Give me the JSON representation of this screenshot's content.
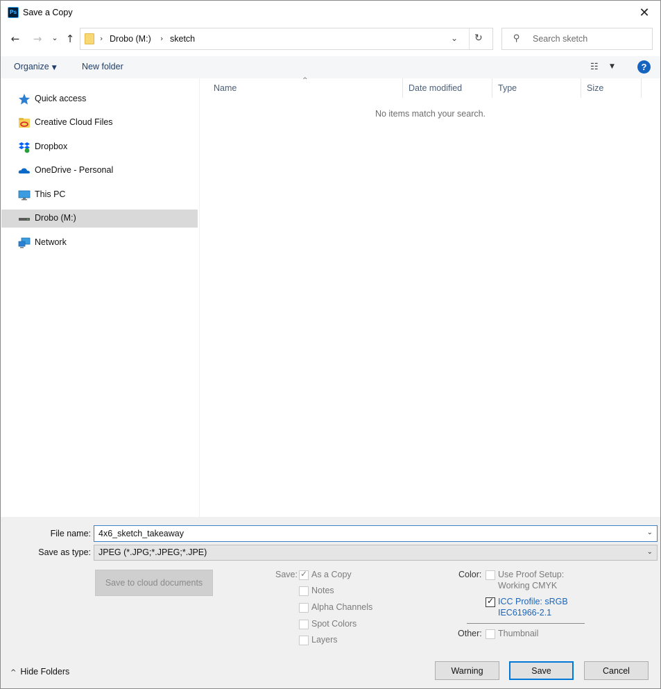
{
  "window": {
    "title": "Save a Copy",
    "app_icon_text": "Ps",
    "close_glyph": "✕"
  },
  "nav": {
    "back_glyph": "←",
    "forward_glyph": "→",
    "recent_glyph": "⌄",
    "up_glyph": "↑",
    "breadcrumbs": [
      "Drobo (M:)",
      "sketch"
    ],
    "crumb_separator": "›",
    "dropdown_glyph": "⌄",
    "refresh_glyph": "↻",
    "search_placeholder": "Search sketch",
    "search_glyph": "⚲"
  },
  "toolbar": {
    "organize_label": "Organize",
    "organize_caret": "▼",
    "new_folder_label": "New folder",
    "view_glyph": "☷",
    "view_caret": "▼",
    "help_glyph": "?"
  },
  "sidebar": {
    "items": [
      {
        "label": "Quick access",
        "icon": "star-icon",
        "selected": false
      },
      {
        "label": "Creative Cloud Files",
        "icon": "creative-cloud-folder-icon",
        "selected": false
      },
      {
        "label": "Dropbox",
        "icon": "dropbox-icon",
        "selected": false
      },
      {
        "label": "OneDrive - Personal",
        "icon": "onedrive-cloud-icon",
        "selected": false
      },
      {
        "label": "This PC",
        "icon": "monitor-icon",
        "selected": false
      },
      {
        "label": "Drobo (M:)",
        "icon": "drive-icon",
        "selected": true
      },
      {
        "label": "Network",
        "icon": "network-icon",
        "selected": false
      }
    ]
  },
  "filelist": {
    "columns": [
      "Name",
      "Date modified",
      "Type",
      "Size"
    ],
    "sort_glyph": "^",
    "empty_message": "No items match your search."
  },
  "form": {
    "file_name_label": "File name:",
    "file_name_value": "4x6_sketch_takeaway",
    "save_as_type_label": "Save as type:",
    "save_as_type_value": "JPEG (*.JPG;*.JPEG;*.JPE)",
    "combo_caret": "⌄",
    "cloud_button_label": "Save to cloud documents"
  },
  "options": {
    "save_label": "Save:",
    "as_a_copy": {
      "label": "As a Copy",
      "checked": true
    },
    "notes": {
      "label": "Notes",
      "checked": false
    },
    "alpha_channels": {
      "label": "Alpha Channels",
      "checked": false
    },
    "spot_colors": {
      "label": "Spot Colors",
      "checked": false
    },
    "layers": {
      "label": "Layers",
      "checked": false
    },
    "color_label": "Color:",
    "use_proof_setup": {
      "label_line1": "Use Proof Setup:",
      "label_line2": "Working CMYK",
      "checked": false
    },
    "icc_profile": {
      "label_line1": "ICC Profile:  sRGB",
      "label_line2": "IEC61966-2.1",
      "checked": true
    },
    "other_label": "Other:",
    "thumbnail": {
      "label": "Thumbnail",
      "checked": false
    },
    "check_glyph": "✓"
  },
  "footer": {
    "hide_folders_label": "Hide Folders",
    "hide_folders_caret": "^",
    "warning_label": "Warning",
    "save_label": "Save",
    "cancel_label": "Cancel"
  },
  "colors": {
    "accent": "#0078d7",
    "link_text": "#1e3d6b",
    "selected_row": "#d9d9d9",
    "icc_text": "#1b64b8"
  }
}
